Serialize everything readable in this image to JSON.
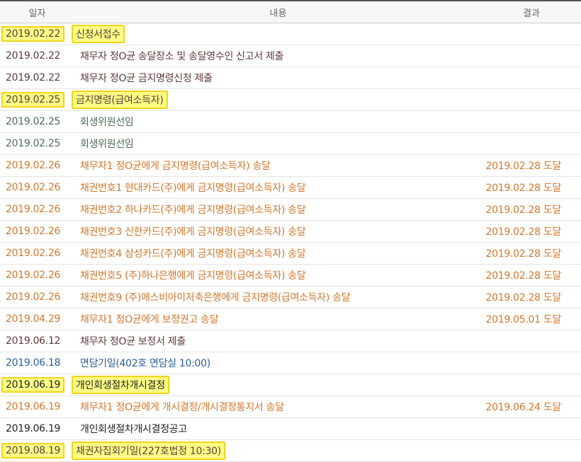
{
  "header": {
    "date": "일자",
    "content": "내용",
    "result": "결과"
  },
  "rows": [
    {
      "date": "2019.02.22",
      "content": "신청서접수",
      "result": ""
    },
    {
      "date": "2019.02.22",
      "content": "채무자 정O균 송달장소 및 송달영수인 신고서 제출",
      "result": ""
    },
    {
      "date": "2019.02.22",
      "content": "채무자 정O균 금지명령신청 제출",
      "result": ""
    },
    {
      "date": "2019.02.25",
      "content": "금지명령(급여소득자)",
      "result": ""
    },
    {
      "date": "2019.02.25",
      "content": "회생위원선임",
      "result": ""
    },
    {
      "date": "2019.02.25",
      "content": "회생위원선임",
      "result": ""
    },
    {
      "date": "2019.02.26",
      "content": "채무자1 정O균에게 금지명령(급여소득자) 송달",
      "result": "2019.02.28 도달"
    },
    {
      "date": "2019.02.26",
      "content": "채권번호1 현대카드(주)에게 금지명령(급여소득자) 송달",
      "result": "2019.02.28 도달"
    },
    {
      "date": "2019.02.26",
      "content": "채권번호2 하나카드(주)에게 금지명령(급여소득자) 송달",
      "result": "2019.02.28 도달"
    },
    {
      "date": "2019.02.26",
      "content": "채권번호3 신한카드(주)에게 금지명령(급여소득자) 송달",
      "result": "2019.02.28 도달"
    },
    {
      "date": "2019.02.26",
      "content": "채권번호4 삼성카드(주)에게 금지명령(급여소득자) 송달",
      "result": "2019.02.28 도달"
    },
    {
      "date": "2019.02.26",
      "content": "채권번호5 (주)하나은행에게 금지명령(급여소득자) 송달",
      "result": "2019.02.28 도달"
    },
    {
      "date": "2019.02.26",
      "content": "채권번호9 (주)에스비아이저축은행에게 금지명령(급여소득자) 송달",
      "result": "2019.02.28 도달"
    },
    {
      "date": "2019.04.29",
      "content": "채무자1 정O균에게 보정권고 송달",
      "result": "2019.05.01 도달"
    },
    {
      "date": "2019.06.12",
      "content": "채무자 정O균 보정서 제출",
      "result": ""
    },
    {
      "date": "2019.06.18",
      "content": "면담기일(402호 면담실 10:00)",
      "result": ""
    },
    {
      "date": "2019.06.19",
      "content": "개인회생절차개시결정",
      "result": ""
    },
    {
      "date": "2019.06.19",
      "content": "채무자1 정O균에게 개시결정/개시결정통지서 송달",
      "result": "2019.06.24 도달"
    },
    {
      "date": "2019.06.19",
      "content": "개인회생절차개시결정공고",
      "result": ""
    },
    {
      "date": "2019.08.19",
      "content": "채권자집회기일(227호법정 10:30)",
      "result": ""
    }
  ]
}
